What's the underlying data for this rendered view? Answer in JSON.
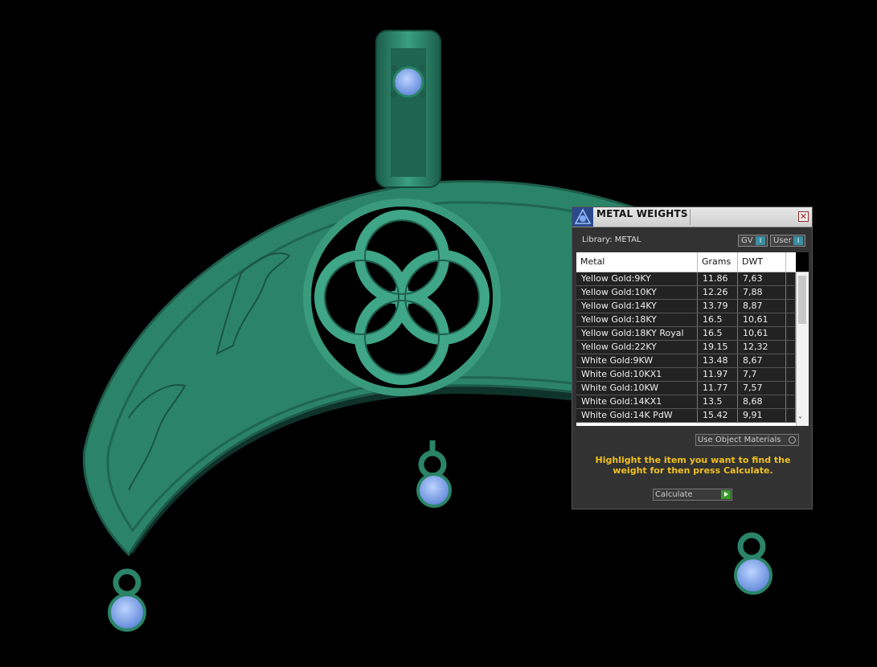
{
  "colors": {
    "metal": "#2e8a70",
    "metal_dark": "#1b5c48",
    "gem": "#7fa8f0",
    "panel_bg": "#323232",
    "hint": "#f0c020"
  },
  "panel": {
    "title": "METAL WEIGHTS",
    "library_label": "Library:  METAL",
    "toggle_gv": "GV",
    "toggle_user": "User",
    "columns": [
      "Metal",
      "Grams",
      "DWT"
    ],
    "rows": [
      {
        "metal": "Yellow Gold:9KY",
        "grams": "11.86",
        "dwt": "7,63"
      },
      {
        "metal": "Yellow Gold:10KY",
        "grams": "12.26",
        "dwt": "7,88"
      },
      {
        "metal": "Yellow Gold:14KY",
        "grams": "13.79",
        "dwt": "8,87"
      },
      {
        "metal": "Yellow Gold:18KY",
        "grams": "16.5",
        "dwt": "10,61"
      },
      {
        "metal": "Yellow Gold:18KY Royal",
        "grams": "16.5",
        "dwt": "10,61"
      },
      {
        "metal": "Yellow Gold:22KY",
        "grams": "19.15",
        "dwt": "12,32"
      },
      {
        "metal": "White Gold:9KW",
        "grams": "13.48",
        "dwt": "8,67"
      },
      {
        "metal": "White Gold:10KX1",
        "grams": "11.97",
        "dwt": "7,7"
      },
      {
        "metal": "White Gold:10KW",
        "grams": "11.77",
        "dwt": "7,57"
      },
      {
        "metal": "White Gold:14KX1",
        "grams": "13.5",
        "dwt": "8,68"
      },
      {
        "metal": "White Gold:14K PdW",
        "grams": "15.42",
        "dwt": "9,91"
      }
    ],
    "use_object_materials": "Use Object Materials",
    "hint": "Highlight the item you want to find the weight for then press Calculate.",
    "calculate": "Calculate"
  }
}
